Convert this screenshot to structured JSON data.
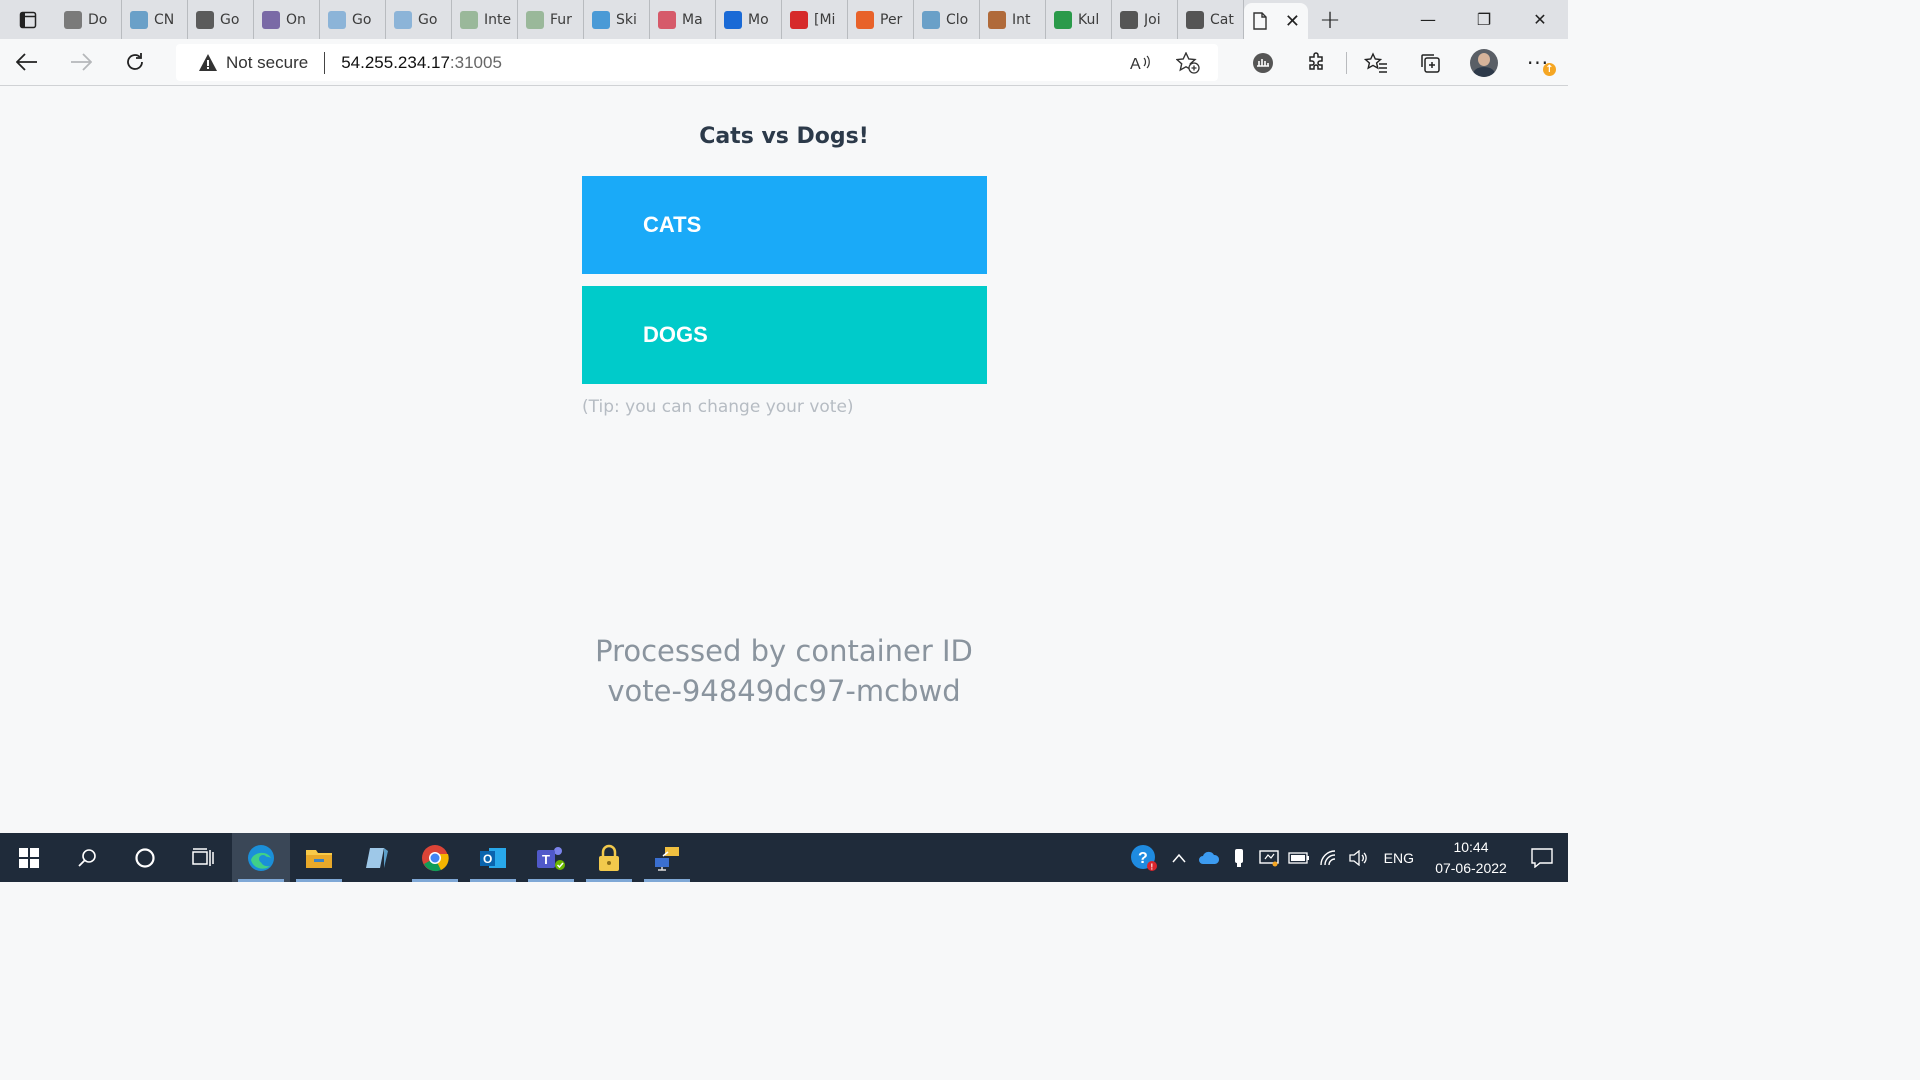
{
  "browser": {
    "tabs": [
      {
        "label": "Do",
        "icon": "diamond-icon",
        "color": "#7a7a7a"
      },
      {
        "label": "CN",
        "icon": "image-icon",
        "color": "#6aa0c8"
      },
      {
        "label": "Go",
        "icon": "braces-icon",
        "color": "#5b5b5b"
      },
      {
        "label": "On",
        "icon": "lightning-icon",
        "color": "#7a6aa6"
      },
      {
        "label": "Go",
        "icon": "map-icon",
        "color": "#8cb4d8"
      },
      {
        "label": "Go",
        "icon": "map-icon",
        "color": "#8cb4d8"
      },
      {
        "label": "Inte",
        "icon": "infinity-icon",
        "color": "#9ab89a"
      },
      {
        "label": "Fur",
        "icon": "infinity-icon",
        "color": "#9ab89a"
      },
      {
        "label": "Ski",
        "icon": "video-icon",
        "color": "#4a9ad6"
      },
      {
        "label": "Ma",
        "icon": "m-logo-icon",
        "color": "#d65a6a"
      },
      {
        "label": "Mo",
        "icon": "edge-e-icon",
        "color": "#1a6ad6"
      },
      {
        "label": "[Mi",
        "icon": "record-icon",
        "color": "#d62a2a"
      },
      {
        "label": "Per",
        "icon": "question-icon",
        "color": "#e8622a"
      },
      {
        "label": "Clo",
        "icon": "pencil-icon",
        "color": "#6aa0c8"
      },
      {
        "label": "Int",
        "icon": "fish-icon",
        "color": "#b06a3a"
      },
      {
        "label": "Kul",
        "icon": "plus-box-icon",
        "color": "#2a9a4a"
      },
      {
        "label": "Joi",
        "icon": "page-icon",
        "color": "#555555"
      },
      {
        "label": "Cat",
        "icon": "page-icon",
        "color": "#555555"
      }
    ],
    "address": {
      "security_label": "Not secure",
      "host": "54.255.234.17",
      "port": ":31005"
    }
  },
  "page": {
    "title": "Cats vs Dogs!",
    "option_a": "CATS",
    "option_b": "DOGS",
    "tip": "(Tip: you can change your vote)",
    "processed_line1": "Processed by container ID",
    "processed_line2": "vote-94849dc97-mcbwd",
    "colors": {
      "cats": "#1aaaf8",
      "dogs": "#00cbca"
    }
  },
  "taskbar": {
    "language": "ENG",
    "time": "10:44",
    "date": "07-06-2022"
  }
}
